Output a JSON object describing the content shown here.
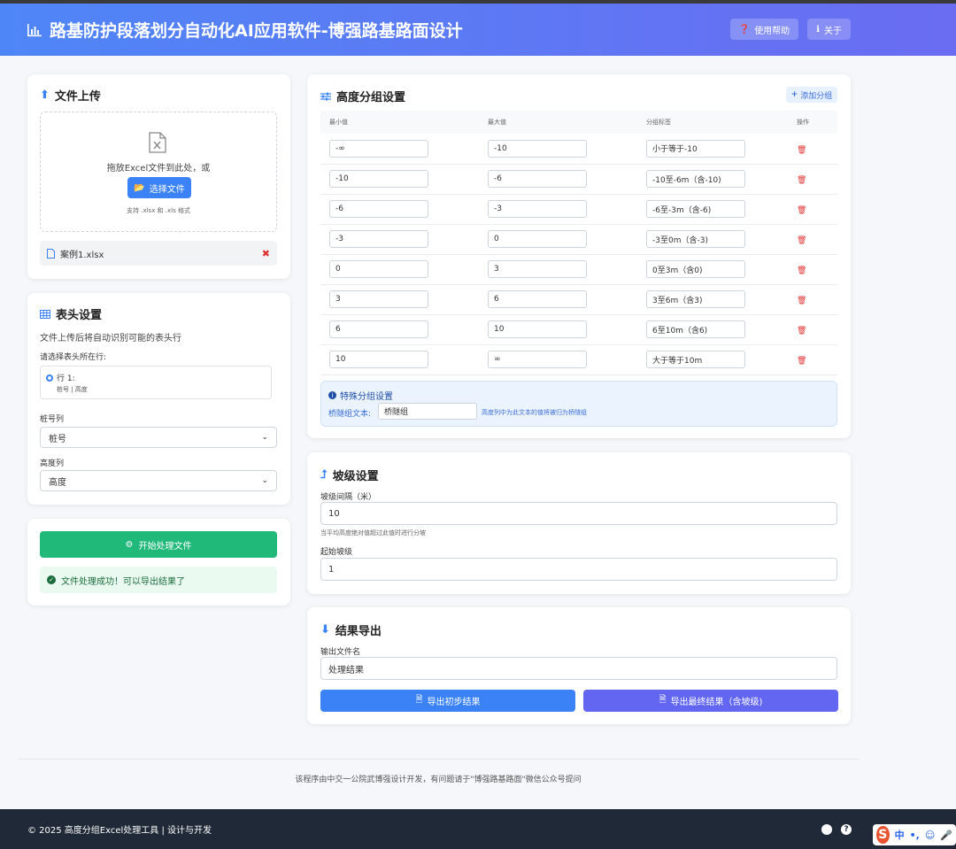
{
  "header": {
    "title": "路基防护段落划分自动化AI应用软件-博强路基路面设计",
    "help_label": "使用帮助",
    "about_label": "关于"
  },
  "upload": {
    "title": "文件上传",
    "drop_text": "拖放Excel文件到此处，或",
    "choose_label": "选择文件",
    "hint": "支持 .xlsx 和 .xls 格式",
    "file_name": "案例1.xlsx"
  },
  "header_settings": {
    "title": "表头设置",
    "desc": "文件上传后将自动识别可能的表头行",
    "select_row_label": "请选择表头所在行:",
    "row_option_label": "行 1:",
    "row_option_detail": "桩号 | 高度",
    "pile_label": "桩号列",
    "pile_value": "桩号",
    "height_label": "高度列",
    "height_value": "高度"
  },
  "process": {
    "start_label": "开始处理文件",
    "success_text": "文件处理成功！可以导出结果了"
  },
  "groups": {
    "title": "高度分组设置",
    "add_label": "添加分组",
    "columns": [
      "最小值",
      "最大值",
      "分组标签",
      "操作"
    ],
    "rows": [
      {
        "min": "-∞",
        "max": "-10",
        "label": "小于等于-10"
      },
      {
        "min": "-10",
        "max": "-6",
        "label": "-10至-6m（含-10)"
      },
      {
        "min": "-6",
        "max": "-3",
        "label": "-6至-3m（含-6)"
      },
      {
        "min": "-3",
        "max": "0",
        "label": "-3至0m（含-3)"
      },
      {
        "min": "0",
        "max": "3",
        "label": "0至3m（含0)"
      },
      {
        "min": "3",
        "max": "6",
        "label": "3至6m（含3)"
      },
      {
        "min": "6",
        "max": "10",
        "label": "6至10m（含6)"
      },
      {
        "min": "10",
        "max": "∞",
        "label": "大于等于10m"
      }
    ],
    "special_title": "特殊分组设置",
    "special_label": "桥隧组文本:",
    "special_value": "桥隧组",
    "special_hint": "高度列中为此文本的值将被归为桥隧组"
  },
  "slope": {
    "title": "坡级设置",
    "interval_label": "坡级间隔（米）",
    "interval_value": "10",
    "interval_hint": "当平均高度绝对值超过此值时进行分坡",
    "start_label": "起始坡级",
    "start_value": "1"
  },
  "export": {
    "title": "结果导出",
    "filename_label": "输出文件名",
    "filename_value": "处理结果",
    "initial_label": "导出初步结果",
    "final_label": "导出最终结果（含坡级)"
  },
  "credit": "该程序由中交一公院武博强设计开发，有问题请于\"博强路基路面\"微信公众号提问",
  "footer": {
    "copyright": "© 2025 高度分组Excel处理工具 | 设计与开发"
  },
  "ime": {
    "logo": "S",
    "lang": "中",
    "punct": "•,"
  },
  "colors": {
    "primary": "#3b82f6",
    "success": "#20b97a",
    "indigo": "#6366f1",
    "danger": "#e03131",
    "footer_bg": "#1f2937"
  }
}
